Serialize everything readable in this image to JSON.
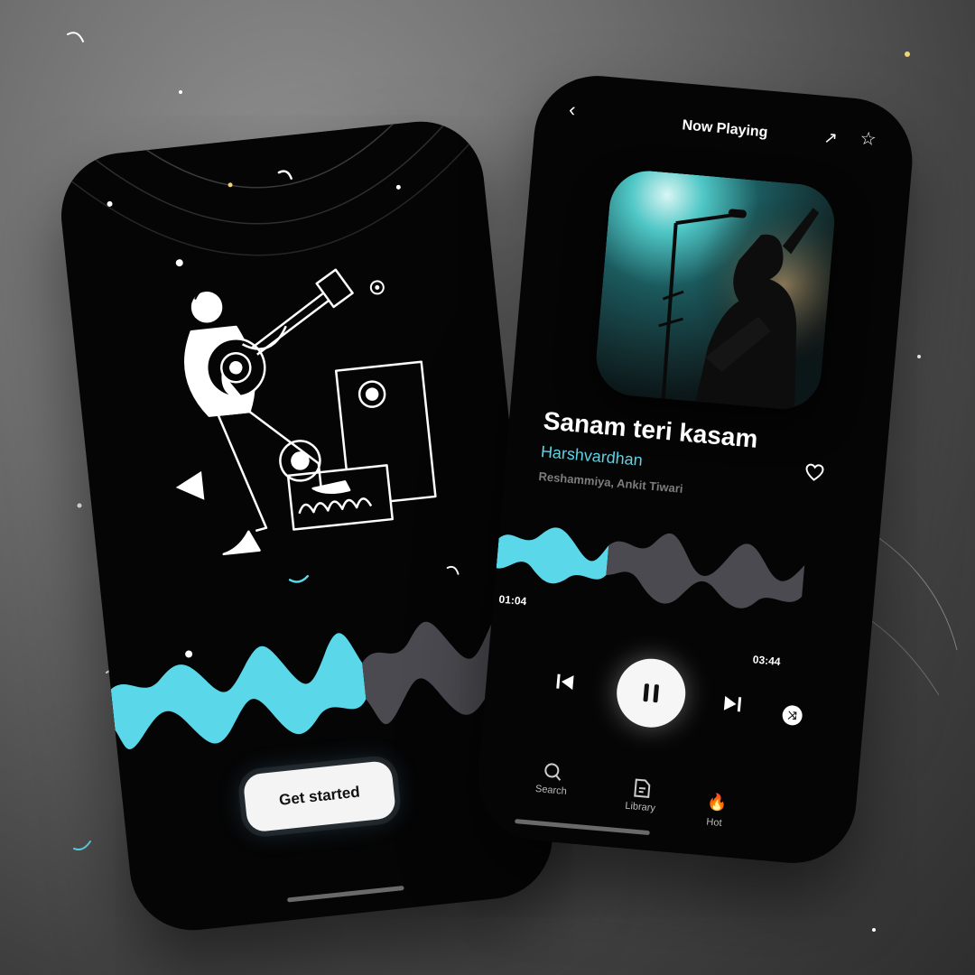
{
  "onboarding": {
    "cta_label": "Get started"
  },
  "player": {
    "header_title": "Now Playing",
    "song_title": "Sanam teri kasam",
    "artist": "Harshvardhan",
    "sub_artists": "Reshammiya, Ankit Tiwari",
    "elapsed": "01:04",
    "duration": "03:44",
    "progress": 0.29
  },
  "nav": {
    "items": [
      {
        "label": "Search",
        "icon": "search-icon"
      },
      {
        "label": "Library",
        "icon": "library-icon"
      },
      {
        "label": "Hot",
        "icon": "fire-icon"
      }
    ]
  },
  "colors": {
    "accent": "#58d6e8",
    "background": "#050505",
    "wave_inactive": "#4a4a50"
  }
}
